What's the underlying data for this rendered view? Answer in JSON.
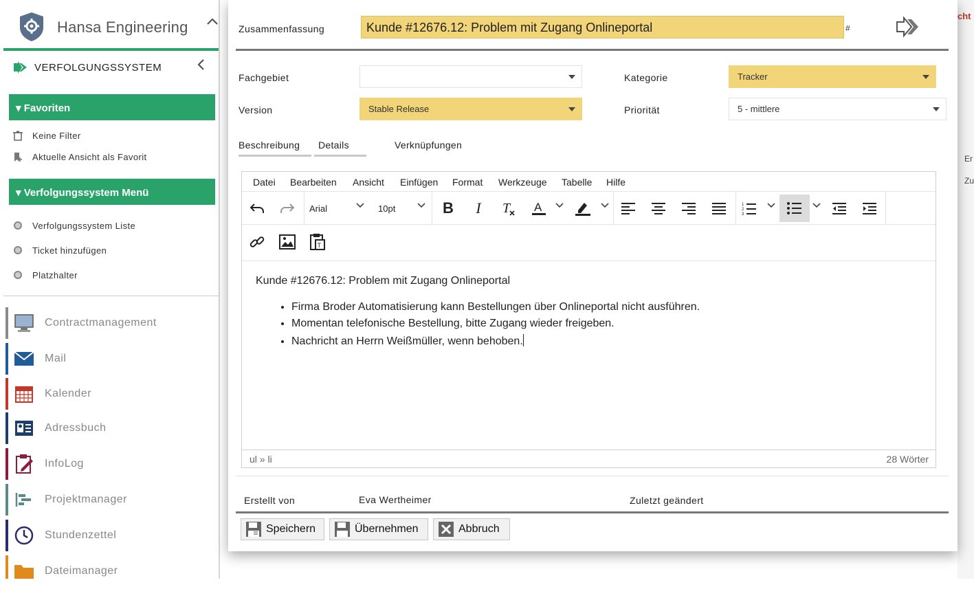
{
  "sidebar": {
    "brand": "Hansa Engineering",
    "app_title": "VERFOLGUNGSSYSTEM",
    "favorites": {
      "heading": "Favoriten",
      "items": [
        "Keine Filter",
        "Aktuelle Ansicht als Favorit"
      ]
    },
    "menu": {
      "heading": "Verfolgungssystem Menü",
      "items": [
        "Verfolgungssystem Liste",
        "Ticket hinzufügen",
        "Platzhalter"
      ]
    },
    "apps": [
      {
        "label": "Contractmanagement",
        "color": "#8a8a8a"
      },
      {
        "label": "Mail",
        "color": "#1f5c99"
      },
      {
        "label": "Kalender",
        "color": "#c0392b"
      },
      {
        "label": "Adressbuch",
        "color": "#1e3d6b"
      },
      {
        "label": "InfoLog",
        "color": "#8e1b3a"
      },
      {
        "label": "Projektmanager",
        "color": "#5a8a8a"
      },
      {
        "label": "Stundenzettel",
        "color": "#2c2c6b"
      },
      {
        "label": "Dateimanager",
        "color": "#e08a1e"
      }
    ]
  },
  "background": {
    "right_title": "cht",
    "right_row1": "Er",
    "right_row2": "Zu"
  },
  "dialog": {
    "summary_label": "Zusammenfassung",
    "summary_value": "Kunde #12676.12: Problem mit Zugang Onlineportal",
    "hash": "#",
    "fields": {
      "fachgebiet_label": "Fachgebiet",
      "fachgebiet_value": "",
      "kategorie_label": "Kategorie",
      "kategorie_value": "Tracker",
      "version_label": "Version",
      "version_value": "Stable Release",
      "prioritaet_label": "Priorität",
      "prioritaet_value": "5 - mittlere"
    },
    "tabs": [
      "Beschreibung",
      "Details",
      "Verknüpfungen"
    ],
    "editor": {
      "menu": [
        "Datei",
        "Bearbeiten",
        "Ansicht",
        "Einfügen",
        "Format",
        "Werkzeuge",
        "Tabelle",
        "Hilfe"
      ],
      "font_family": "Arial",
      "font_size": "10pt",
      "heading": "Kunde #12676.12: Problem mit Zugang Onlineportal",
      "bullets": [
        "Firma Broder Automatisierung kann Bestellungen über Onlineportal nicht ausführen.",
        "Momentan telefonische Bestellung, bitte Zugang wieder freigeben.",
        "Nachricht an Herrn Weißmüller, wenn behoben."
      ],
      "path": "ul » li",
      "word_count": "28 Wörter"
    },
    "created_by_label": "Erstellt von",
    "created_by_value": "Eva Wertheimer",
    "modified_label": "Zuletzt geändert",
    "buttons": {
      "save": "Speichern",
      "apply": "Übernehmen",
      "cancel": "Abbruch"
    }
  }
}
